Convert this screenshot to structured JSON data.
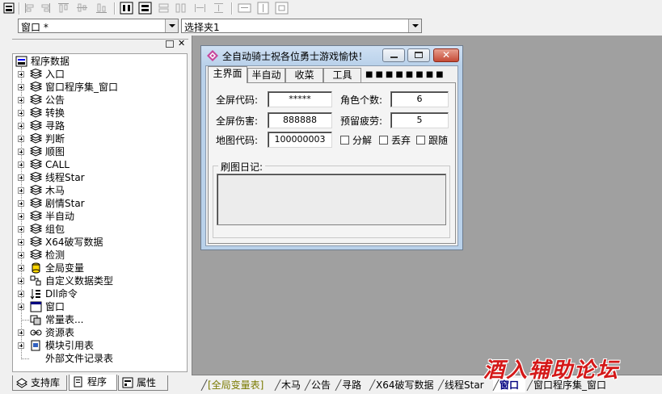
{
  "combos": {
    "object": "窗口 *",
    "selector": "选择夹1"
  },
  "tree": {
    "root": "程序数据",
    "items": [
      {
        "label": "入口",
        "icon": "module-icon"
      },
      {
        "label": "窗口程序集_窗口",
        "icon": "module-icon"
      },
      {
        "label": "公告",
        "icon": "module-icon"
      },
      {
        "label": "转换",
        "icon": "module-icon"
      },
      {
        "label": "寻路",
        "icon": "module-icon"
      },
      {
        "label": "判断",
        "icon": "module-icon"
      },
      {
        "label": "顺图",
        "icon": "module-icon"
      },
      {
        "label": "CALL",
        "icon": "module-icon"
      },
      {
        "label": "线程Star",
        "icon": "module-icon"
      },
      {
        "label": "木马",
        "icon": "module-icon"
      },
      {
        "label": "剧情Star",
        "icon": "module-icon"
      },
      {
        "label": "半自动",
        "icon": "module-icon"
      },
      {
        "label": "组包",
        "icon": "module-icon"
      },
      {
        "label": "X64破写数据",
        "icon": "module-icon"
      },
      {
        "label": "检测",
        "icon": "module-icon"
      },
      {
        "label": "全局变量",
        "icon": "global-variable-icon"
      },
      {
        "label": "自定义数据类型",
        "icon": "datatype-icon"
      },
      {
        "label": "Dll命令",
        "icon": "dll-command-icon"
      },
      {
        "label": "窗口",
        "icon": "window-icon"
      },
      {
        "label": "常量表...",
        "icon": "constant-table-icon"
      },
      {
        "label": "资源表",
        "icon": "resource-table-icon"
      },
      {
        "label": "模块引用表",
        "icon": "module-reference-icon"
      },
      {
        "label": "外部文件记录表",
        "icon": "file-record-icon"
      }
    ]
  },
  "left_tabs": [
    "支持库",
    "程序",
    "属性"
  ],
  "doc_tabs": [
    "[全局变量表]",
    "木马",
    "公告",
    "寻路",
    "X64破写数据",
    "线程Star",
    "窗口",
    "窗口程序集_窗口"
  ],
  "active_doc_tab": "窗口",
  "dialog": {
    "title": "全自动骑士祝各位勇士游戏愉快！",
    "tabs": [
      "主界面",
      "半自动",
      "收菜",
      "工具"
    ],
    "tab_overflow": "■■■■■■■■",
    "fields": {
      "screen_code_label": "全屏代码:",
      "screen_code_value": "*****",
      "role_count_label": "角色个数:",
      "role_count_value": "6",
      "screen_damage_label": "全屏伤害:",
      "screen_damage_value": "888888",
      "reserve_fatigue_label": "预留疲劳:",
      "reserve_fatigue_value": "5",
      "map_code_label": "地图代码:",
      "map_code_value": "100000003",
      "decompose_label": "分解",
      "discard_label": "丢弃",
      "follow_label": "跟随"
    },
    "log_title": "刷图日记:"
  },
  "watermark": "酒入辅助论坛"
}
